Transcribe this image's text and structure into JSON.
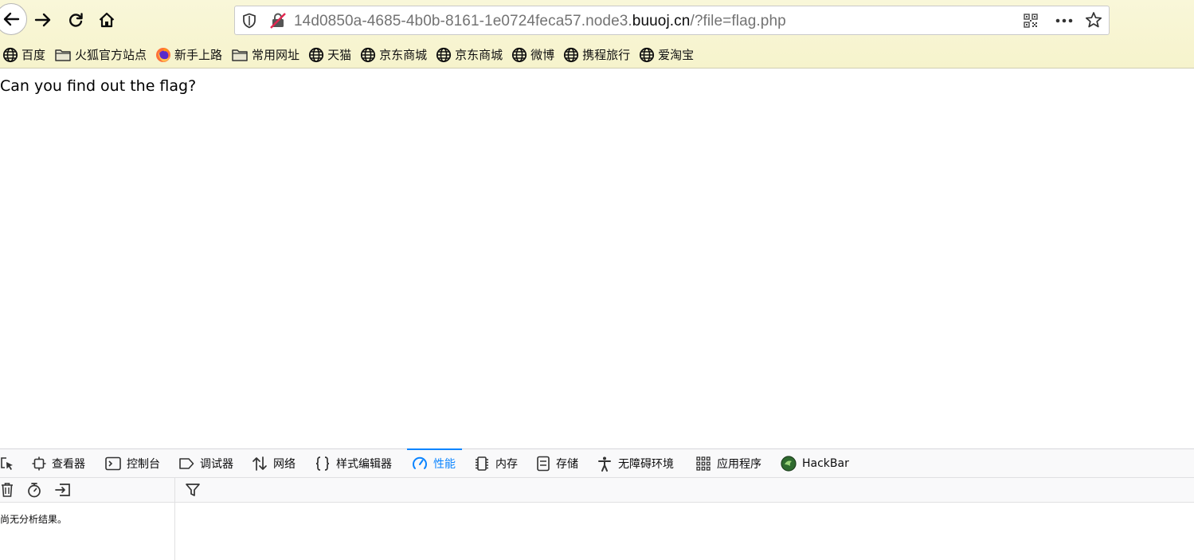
{
  "browser": {
    "url": {
      "prefix": "14d0850a-4685-4b0b-8161-1e0724feca57.node3.",
      "domain": "buuoj.cn",
      "suffix": "/?file=flag.php"
    },
    "buttons": {
      "back_icon": "arrow-left",
      "forward_icon": "arrow-right",
      "reload_icon": "reload",
      "home_icon": "home"
    },
    "bookmarks": [
      {
        "label": "百度",
        "icon": "globe-icon"
      },
      {
        "label": "火狐官方站点",
        "icon": "folder-icon"
      },
      {
        "label": "新手上路",
        "icon": "firefox-icon"
      },
      {
        "label": "常用网址",
        "icon": "folder-icon"
      },
      {
        "label": "天猫",
        "icon": "globe-icon"
      },
      {
        "label": "京东商城",
        "icon": "globe-icon"
      },
      {
        "label": "京东商城",
        "icon": "globe-icon"
      },
      {
        "label": "微博",
        "icon": "globe-icon"
      },
      {
        "label": "携程旅行",
        "icon": "globe-icon"
      },
      {
        "label": "爱淘宝",
        "icon": "globe-icon"
      }
    ]
  },
  "page": {
    "text": "Can you find out the flag?"
  },
  "devtools": {
    "tabs": [
      {
        "label": "查看器",
        "icon": "inspector-icon"
      },
      {
        "label": "控制台",
        "icon": "console-icon"
      },
      {
        "label": "调试器",
        "icon": "debugger-icon"
      },
      {
        "label": "网络",
        "icon": "network-icon"
      },
      {
        "label": "样式编辑器",
        "icon": "style-editor-icon"
      },
      {
        "label": "性能",
        "icon": "performance-icon",
        "selected": true
      },
      {
        "label": "内存",
        "icon": "memory-icon"
      },
      {
        "label": "存储",
        "icon": "storage-icon"
      },
      {
        "label": "无障碍环境",
        "icon": "accessibility-icon"
      },
      {
        "label": "应用程序",
        "icon": "application-icon"
      },
      {
        "label": "HackBar",
        "icon": "hackbar-icon"
      }
    ],
    "sidebar_message": "尚无分析结果。",
    "accent_color": "#0a84ff"
  }
}
